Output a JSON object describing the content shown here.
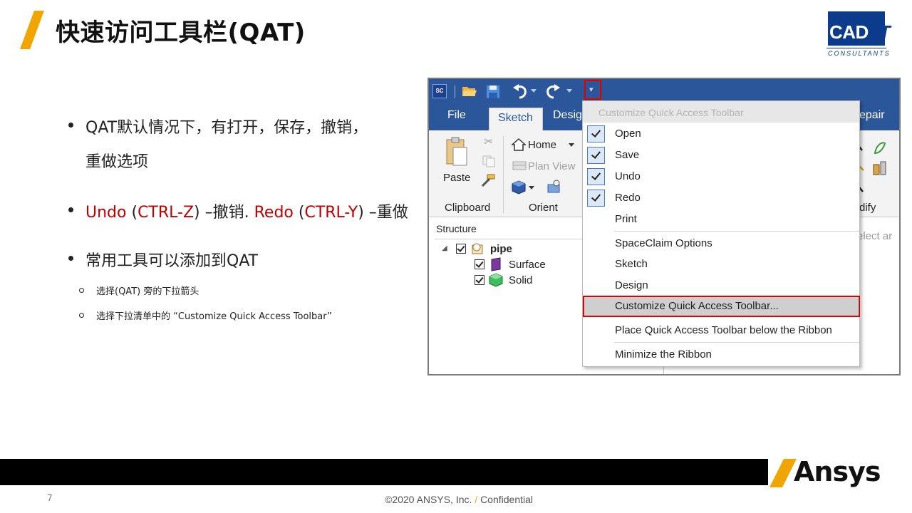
{
  "slide": {
    "title": "快速访问工具栏(QAT)",
    "page_number": "7",
    "copyright_main": "©2020 ANSYS, Inc.",
    "copyright_slash": "/",
    "copyright_tail": "Confidential",
    "accent_color": "#f0a500"
  },
  "logo": {
    "cad": "CAD",
    "it": "-IT",
    "sub": "CONSULTANTS"
  },
  "brand": {
    "name": "Ansys"
  },
  "bullets": {
    "b1_line1": "QAT默认情况下，有打开，保存，撤销，",
    "b1_line2": "重做选项",
    "b2_undo": "Undo",
    "b2_paren_open": " (",
    "b2_ctrlz": "CTRL-Z",
    "b2_mid": ") –撤销. ",
    "b2_redo": "Redo",
    "b2_paren_open2": " (",
    "b2_ctrly": "CTRL-Y",
    "b2_end": ") –重做",
    "b3": "常用工具可以添加到QAT",
    "sub1": "选择(QAT) 旁的下拉箭头",
    "sub2": "选择下拉清单中的 “Customize Quick Access Toolbar”"
  },
  "app": {
    "sc_logo": "SC",
    "qat_dropdown_glyph": "▾",
    "tabs": {
      "file": "File",
      "sketch": "Sketch",
      "design": "Desig",
      "repair": "epair"
    },
    "ribbon": {
      "paste": "Paste",
      "clipboard": "Clipboard",
      "home": "Home",
      "plan_view": "Plan View",
      "orient": "Orient",
      "modify": "dify"
    },
    "structure": {
      "title": "Structure",
      "expander": "◢",
      "root": "pipe",
      "children": [
        "Surface",
        "Solid"
      ]
    },
    "right_pane_hint": "elect ar"
  },
  "menu": {
    "header": "Customize Quick Access Toolbar",
    "checked_items": [
      "Open",
      "Save",
      "Undo",
      "Redo"
    ],
    "print": "Print",
    "options": [
      "SpaceClaim Options",
      "Sketch",
      "Design"
    ],
    "customize": "Customize Quick Access Toolbar...",
    "place_below": "Place Quick Access Toolbar below the Ribbon",
    "minimize": "Minimize the Ribbon"
  }
}
